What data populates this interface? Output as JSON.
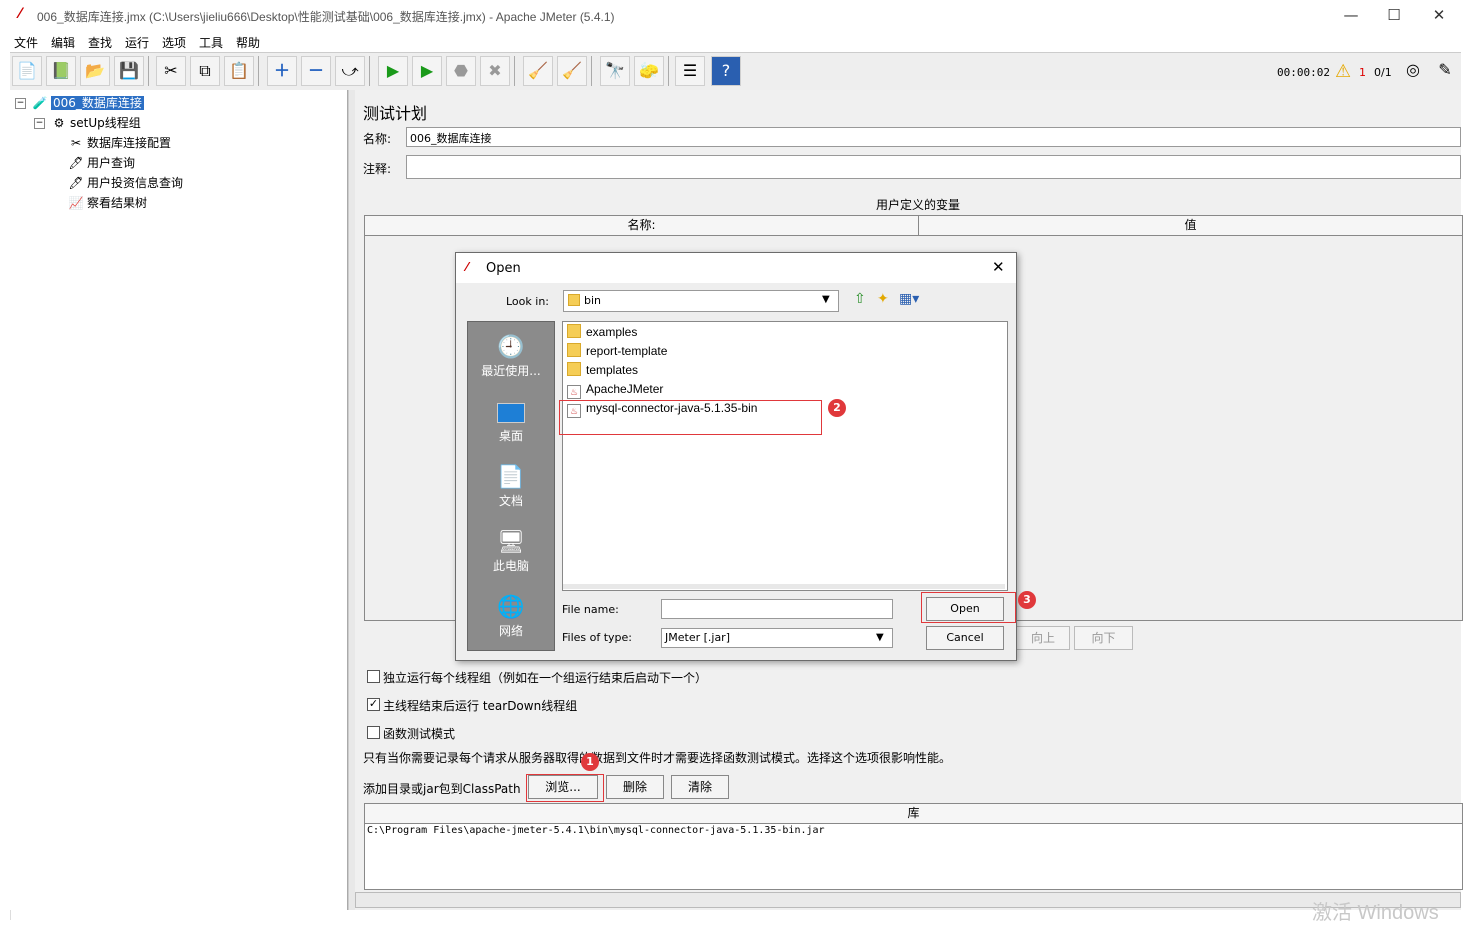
{
  "window": {
    "title": "006_数据库连接.jmx (C:\\Users\\jieliu666\\Desktop\\性能测试基础\\006_数据库连接.jmx) - Apache JMeter (5.4.1)",
    "minimize": "—",
    "maximize": "☐",
    "close": "✕"
  },
  "menu": [
    "文件",
    "编辑",
    "查找",
    "运行",
    "选项",
    "工具",
    "帮助"
  ],
  "toolbar": {
    "timer": "00:00:02",
    "warning_count": "1",
    "threads": "0/1"
  },
  "tree": {
    "root": "006_数据库连接",
    "setup_group": "setUp线程组",
    "children": [
      "数据库连接配置",
      "用户查询",
      "用户投资信息查询",
      "察看结果树"
    ]
  },
  "test_plan": {
    "heading": "测试计划",
    "name_label": "名称:",
    "name_value": "006_数据库连接",
    "comment_label": "注释:",
    "comment_value": "",
    "variables_title": "用户定义的变量",
    "col_name": "名称:",
    "col_value": "值",
    "buttons": {
      "up": "向上",
      "down": "向下"
    },
    "options": [
      {
        "label": "独立运行每个线程组（例如在一个组运行结束后启动下一个）",
        "checked": false
      },
      {
        "label": "主线程结束后运行 tearDown线程组",
        "checked": true
      },
      {
        "label": "函数测试模式",
        "checked": false
      }
    ],
    "note": "只有当你需要记录每个请求从服务器取得的数据到文件时才需要选择函数测试模式。选择这个选项很影响性能。",
    "classpath_label": "添加目录或jar包到ClassPath",
    "browse": "浏览...",
    "delete": "删除",
    "clear": "清除",
    "library_header": "库",
    "library_row": "C:\\Program Files\\apache-jmeter-5.4.1\\bin\\mysql-connector-java-5.1.35-bin.jar"
  },
  "dialog": {
    "title": "Open",
    "look_in_label": "Look in:",
    "look_in_value": "bin",
    "places": [
      "最近使用...",
      "桌面",
      "文档",
      "此电脑",
      "网络"
    ],
    "files": [
      {
        "name": "examples",
        "type": "folder"
      },
      {
        "name": "report-template",
        "type": "folder"
      },
      {
        "name": "templates",
        "type": "folder"
      },
      {
        "name": "ApacheJMeter",
        "type": "jar"
      },
      {
        "name": "mysql-connector-java-5.1.35-bin",
        "type": "jar"
      }
    ],
    "file_name_label": "File name:",
    "file_name_value": "",
    "file_type_label": "Files of type:",
    "file_type_value": "JMeter [.jar]",
    "open": "Open",
    "cancel": "Cancel"
  },
  "annotations": [
    "1",
    "2",
    "3"
  ],
  "watermark": "激活 Windows"
}
